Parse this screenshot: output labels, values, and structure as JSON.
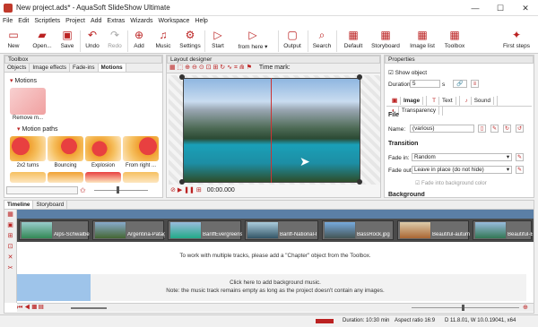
{
  "window": {
    "title": "New project.ads* - AquaSoft SlideShow Ultimate",
    "minimize": "—",
    "maximize": "☐",
    "close": "✕"
  },
  "menu": [
    "File",
    "Edit",
    "Scriptlets",
    "Project",
    "Add",
    "Extras",
    "Wizards",
    "Workspace",
    "Help"
  ],
  "toolbar": {
    "new": "New",
    "open": "Open...",
    "save": "Save",
    "undo": "Undo",
    "redo": "Redo",
    "add": "Add",
    "music": "Music",
    "settings": "Settings",
    "start": "Start",
    "from_here": "from here",
    "output": "Output",
    "search": "Search",
    "default": "Default",
    "storyboard": "Storyboard",
    "image_list": "Image list",
    "toolbox": "Toolbox",
    "first_steps": "First steps"
  },
  "toolbox": {
    "header": "Toolbox",
    "tabs": [
      "Objects",
      "Image effects",
      "Fade-ins",
      "Motions"
    ],
    "section_motions": "Motions",
    "remove_label": "Remove m...",
    "section_paths": "Motion paths",
    "paths": [
      "2x2 turns",
      "Bouncing",
      "Explosion",
      "From right ..."
    ],
    "colors": {
      "tile_a": "#e84040",
      "tile_b": "#f0a030"
    }
  },
  "designer": {
    "header": "Layout designer",
    "time_mark": "Time mark:",
    "time": "00:00.000"
  },
  "properties": {
    "header": "Properties",
    "show_object": "Show object",
    "duration_label": "Duration:",
    "duration_value": "5",
    "duration_unit": "s",
    "tabs": [
      "Image",
      "Text",
      "Sound",
      "Transparency"
    ],
    "file_section": "File",
    "name_label": "Name:",
    "name_value": "(various)",
    "transition_section": "Transition",
    "fade_in_label": "Fade in:",
    "fade_in_value": "Random",
    "fade_out_label": "Fade out:",
    "fade_out_value": "Leave in place (do not hide)",
    "fade_bg": "Fade into background color",
    "background_section": "Background"
  },
  "timeline": {
    "tabs": [
      "Timeline",
      "Storyboard"
    ],
    "clips": [
      "Alps-Schwalben",
      "Argentina-Patag",
      "BanffEvergreens",
      "Banff-National-I",
      "BassRock.jpg",
      "Beautiful-autum",
      "Beautiful-B"
    ],
    "chapter_hint": "To work with multiple tracks, please add a \"Chapter\" object from the Toolbox.",
    "music_hint1": "Click here to add background music.",
    "music_hint2": "Note: the music track remains empty as long as the project doesn't contain any images."
  },
  "status": {
    "duration": "Duration: 10:30 min",
    "aspect": "Aspect ratio 16:9",
    "build": "D 11.8.01, W 10.0.19041, x64"
  }
}
